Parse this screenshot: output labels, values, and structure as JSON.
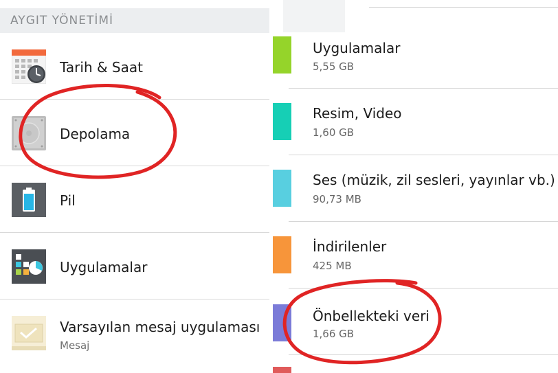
{
  "left": {
    "header": "AYGIT YÖNETİMİ",
    "items": [
      {
        "title": "Tarih & Saat",
        "subtitle": "",
        "icon": "calendar-clock-icon"
      },
      {
        "title": "Depolama",
        "subtitle": "",
        "icon": "storage-drive-icon"
      },
      {
        "title": "Pil",
        "subtitle": "",
        "icon": "battery-icon"
      },
      {
        "title": "Uygulamalar",
        "subtitle": "",
        "icon": "apps-chart-icon"
      },
      {
        "title": "Varsayılan mesaj uygulaması",
        "subtitle": "Mesaj",
        "icon": "envelope-icon"
      }
    ]
  },
  "right": {
    "items": [
      {
        "title": "Uygulamalar",
        "size": "5,55 GB",
        "color": "#95d42a"
      },
      {
        "title": "Resim, Video",
        "size": "1,60 GB",
        "color": "#16cfb5"
      },
      {
        "title": "Ses (müzik, zil sesleri, yayınlar vb.)",
        "size": "90,73 MB",
        "color": "#58cfe0"
      },
      {
        "title": "İndirilenler",
        "size": "425 MB",
        "color": "#f7953a"
      },
      {
        "title": "Önbellekteki veri",
        "size": "1,66 GB",
        "color": "#7b7bd8"
      }
    ]
  },
  "colors": {
    "annotation": "#e02424",
    "header_bg": "#eceef0",
    "divider": "#d6d6d6"
  }
}
